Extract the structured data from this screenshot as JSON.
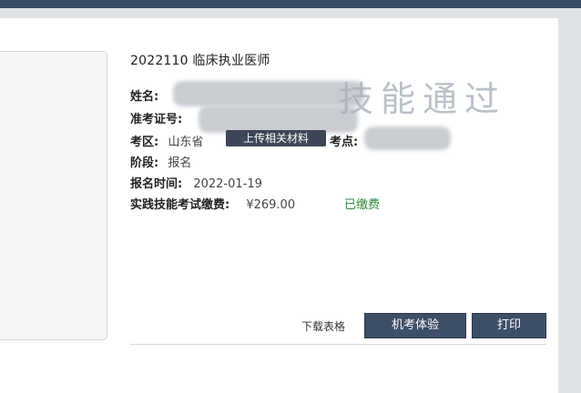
{
  "exam": {
    "title": "2022110 临床执业医师"
  },
  "fields": {
    "name_label": "姓名:",
    "ticket_label": "准考证号:",
    "area_label": "考区:",
    "area_value": "山东省",
    "point_label": "考点:",
    "stage_label": "阶段:",
    "stage_value": "报名",
    "regtime_label": "报名时间:",
    "regtime_value": "2022-01-19",
    "fee_label": "实践技能考试缴费:",
    "fee_value": "¥269.00",
    "fee_status": "已缴费"
  },
  "buttons": {
    "upload": "上传相关材料",
    "download": "下载表格",
    "mock_exam": "机考体验",
    "print": "打印"
  },
  "watermark": "技能通过",
  "colors": {
    "topbar": "#3c4c62",
    "button": "#3d4e66",
    "paid": "#2f8a3a"
  }
}
